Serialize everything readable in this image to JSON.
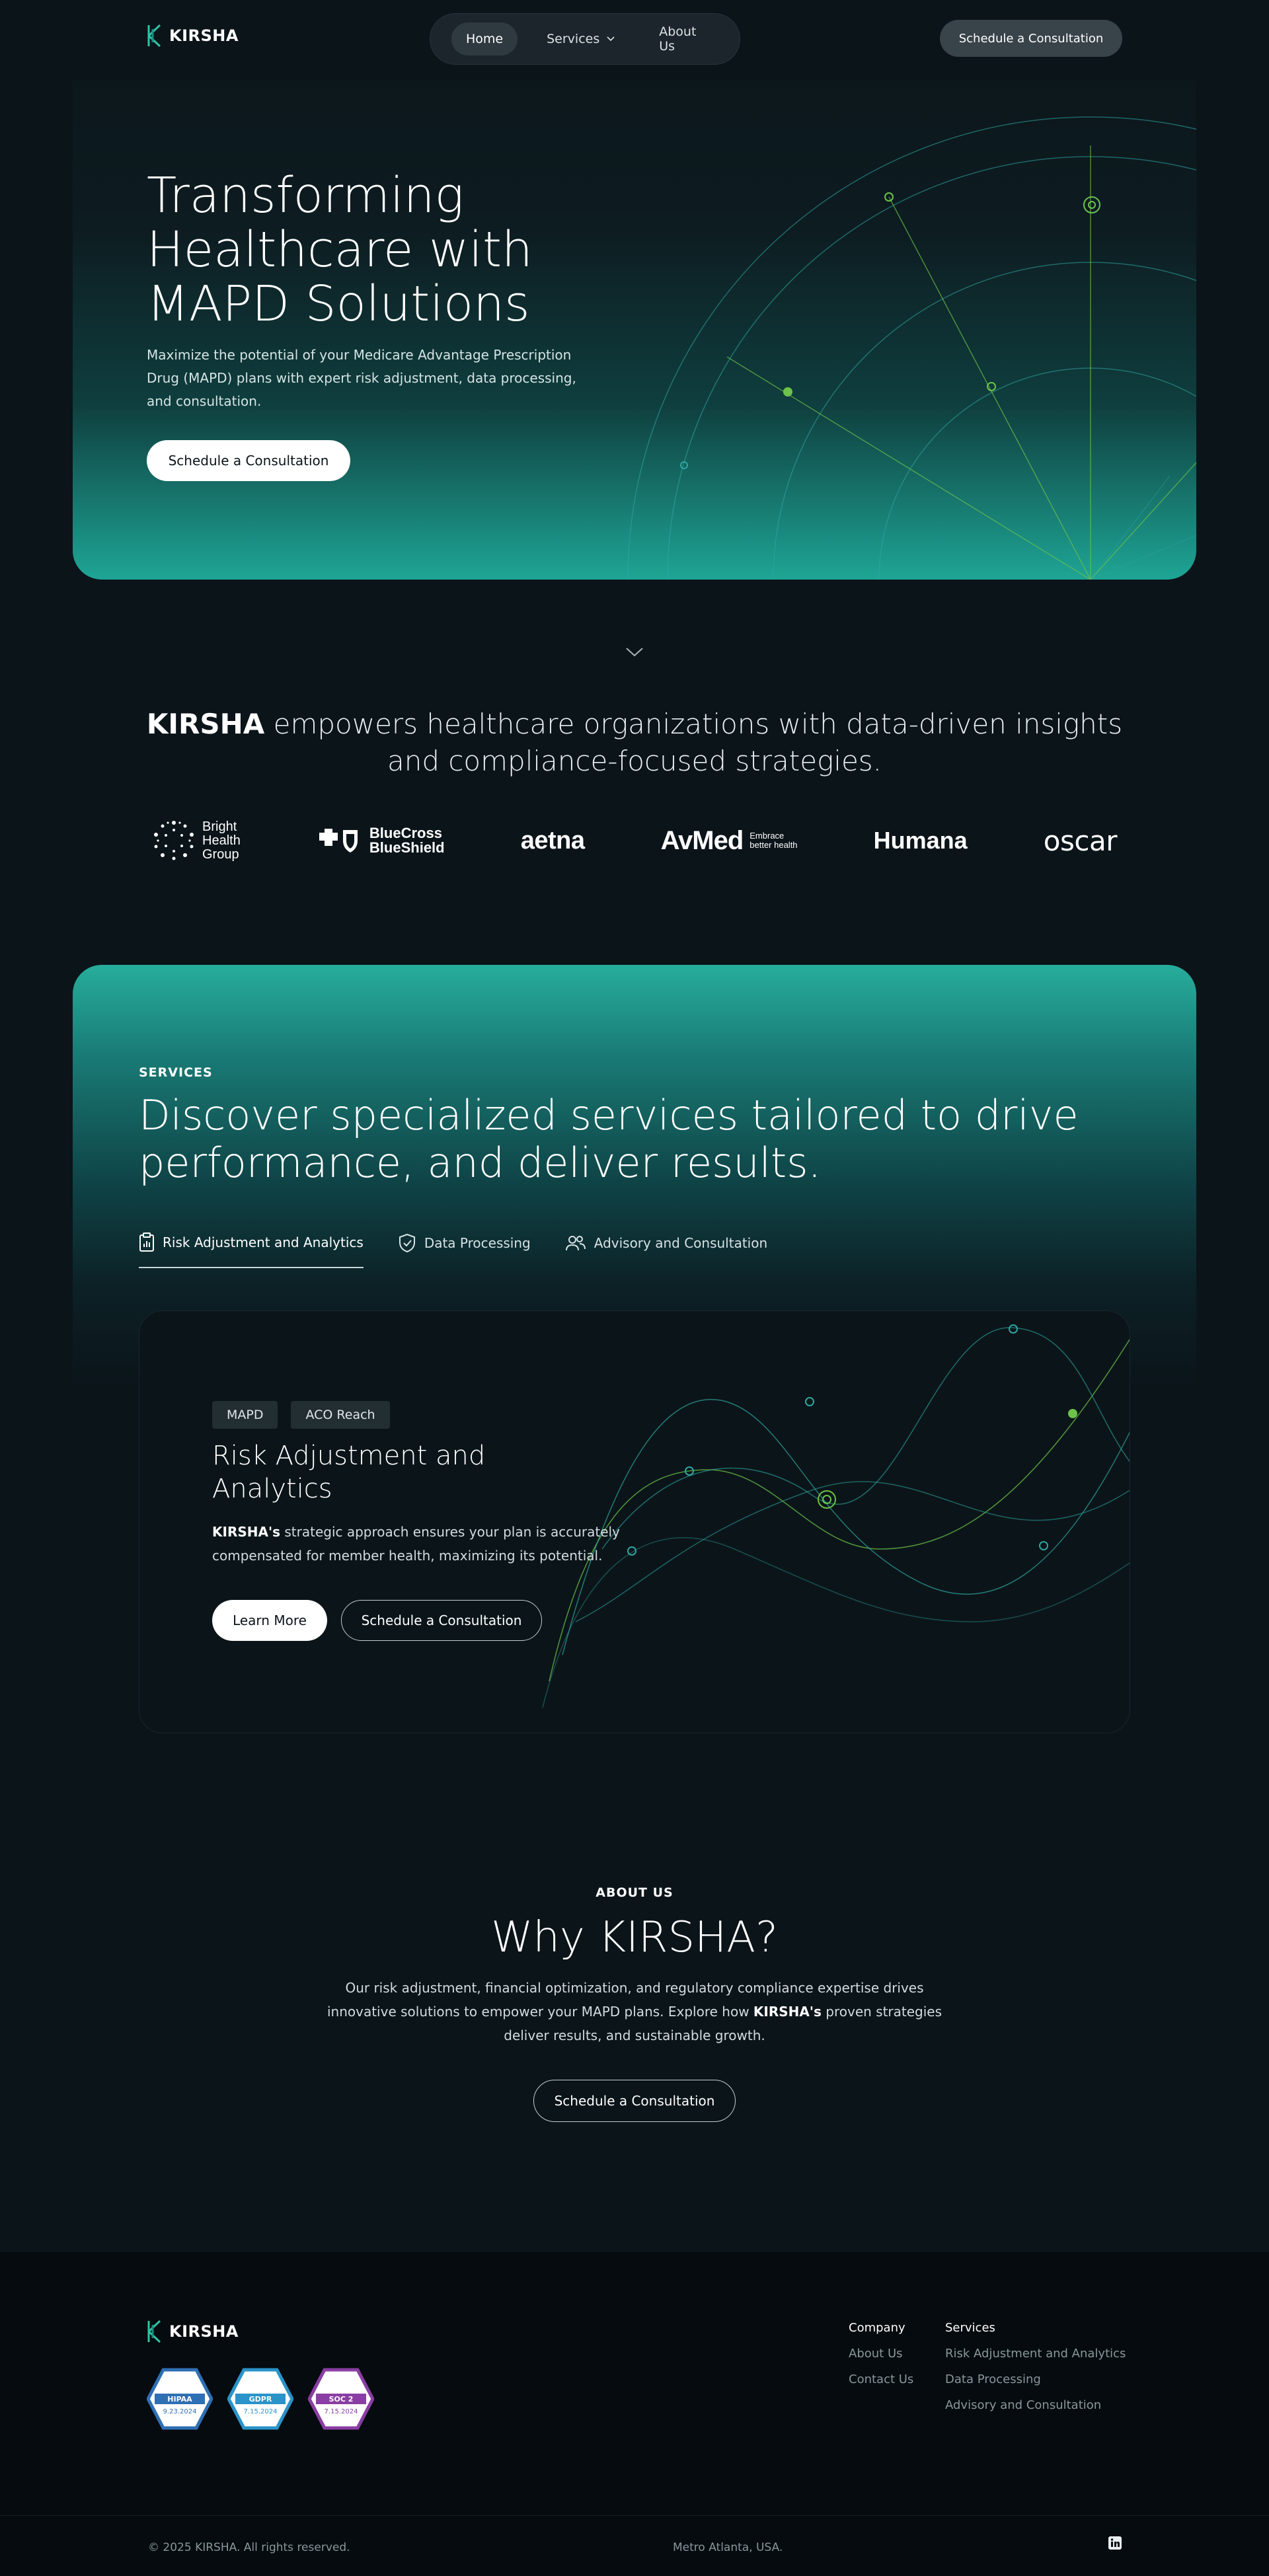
{
  "brand": {
    "name": "KIRSHA"
  },
  "nav": {
    "items": [
      {
        "label": "Home",
        "active": true
      },
      {
        "label": "Services",
        "active": false,
        "has_dropdown": true
      },
      {
        "label": "About Us",
        "active": false
      }
    ],
    "cta_label": "Schedule a Consultation"
  },
  "hero": {
    "title": "Transforming Healthcare with MAPD Solutions",
    "subtitle": "Maximize the potential of your Medicare Advantage Prescription Drug (MAPD) plans with expert risk adjustment, data processing, and consultation.",
    "cta_label": "Schedule a Consultation"
  },
  "tagline": {
    "brand": "KIRSHA",
    "text": " empowers healthcare organizations with data-driven insights and compliance-focused strategies."
  },
  "partners": [
    {
      "name": "Bright Health Group",
      "line1": "Bright",
      "line2": "Health",
      "line3": "Group"
    },
    {
      "name": "BlueCross BlueShield",
      "line1": "BlueCross",
      "line2": "BlueShield"
    },
    {
      "name": "aetna",
      "line1": "aetna"
    },
    {
      "name": "AvMed",
      "line1": "AvMed",
      "line2": "Embrace",
      "line3": "better health"
    },
    {
      "name": "Humana",
      "line1": "Humana"
    },
    {
      "name": "oscar",
      "line1": "oscar"
    }
  ],
  "services": {
    "eyebrow": "SERVICES",
    "title": "Discover specialized services tailored to drive performance, and deliver results.",
    "tabs": [
      {
        "label": "Risk Adjustment and Analytics",
        "icon": "clipboard-chart-icon",
        "active": true
      },
      {
        "label": "Data Processing",
        "icon": "shield-check-icon",
        "active": false
      },
      {
        "label": "Advisory and Consultation",
        "icon": "users-icon",
        "active": false
      }
    ],
    "card": {
      "chips": [
        "MAPD",
        "ACO Reach"
      ],
      "title": "Risk Adjustment and Analytics",
      "text_brand": "KIRSHA's",
      "text": " strategic approach ensures your plan is accurately compensated for member health, maximizing its potential.",
      "primary_label": "Learn More",
      "secondary_label": "Schedule a Consultation"
    }
  },
  "about": {
    "eyebrow": "ABOUT US",
    "title": "Why KIRSHA?",
    "text_a": "Our risk adjustment, financial optimization, and regulatory compliance expertise drives innovative solutions to empower your MAPD plans. Explore how ",
    "text_brand": "KIRSHA's",
    "text_b": " proven strategies deliver results, and sustainable growth.",
    "cta_label": "Schedule a Consultation"
  },
  "footer": {
    "badges": [
      {
        "title": "HIPAA",
        "date": "9.23.2024",
        "color": "#2f6fb3"
      },
      {
        "title": "GDPR",
        "date": "7.15.2024",
        "color": "#2a93c9"
      },
      {
        "title": "SOC 2",
        "date": "7.15.2024",
        "color": "#8a3ea3"
      }
    ],
    "company": {
      "heading": "Company",
      "links": [
        "About Us",
        "Contact Us"
      ]
    },
    "services": {
      "heading": "Services",
      "links": [
        "Risk Adjustment and Analytics",
        "Data Processing",
        "Advisory and Consultation"
      ]
    },
    "copyright": "© 2025 KIRSHA. All rights reserved.",
    "location": "Metro Atlanta, USA.",
    "social": "linkedin-icon"
  },
  "colors": {
    "accent": "#27ad9c",
    "background": "#0b1419",
    "footer": "#050b0f",
    "chart_green": "#6cc24a"
  }
}
